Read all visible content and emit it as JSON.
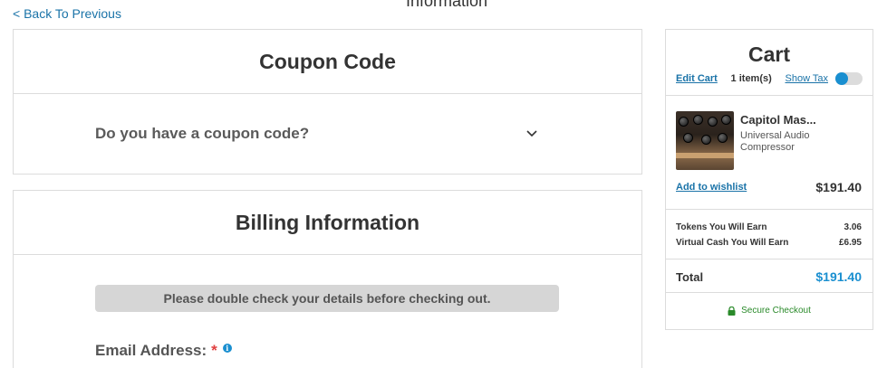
{
  "nav": {
    "back_label": "< Back To Previous",
    "page_title_partial": "Information"
  },
  "coupon": {
    "title": "Coupon Code",
    "question": "Do you have a coupon code?"
  },
  "billing": {
    "title": "Billing Information",
    "notice": "Please double check your details before checking out.",
    "email_label": "Email Address:",
    "required_mark": "*",
    "info_glyph": "i"
  },
  "cart": {
    "title": "Cart",
    "edit_label": "Edit Cart",
    "item_count": "1 item(s)",
    "show_tax_label": "Show Tax",
    "show_tax_enabled": false,
    "item": {
      "name": "Capitol Mas...",
      "brand": "Universal Audio",
      "category": "Compressor",
      "wishlist_label": "Add to wishlist",
      "price": "$191.40"
    },
    "earn": [
      {
        "label": "Tokens You Will Earn",
        "value": "3.06"
      },
      {
        "label": "Virtual Cash You Will Earn",
        "value": "£6.95"
      }
    ],
    "total_label": "Total",
    "total_value": "$191.40",
    "secure_label": "Secure Checkout"
  },
  "colors": {
    "link": "#1a73a8",
    "accent": "#1a8fd0",
    "secure": "#2a8a2a",
    "required": "#e04040"
  }
}
